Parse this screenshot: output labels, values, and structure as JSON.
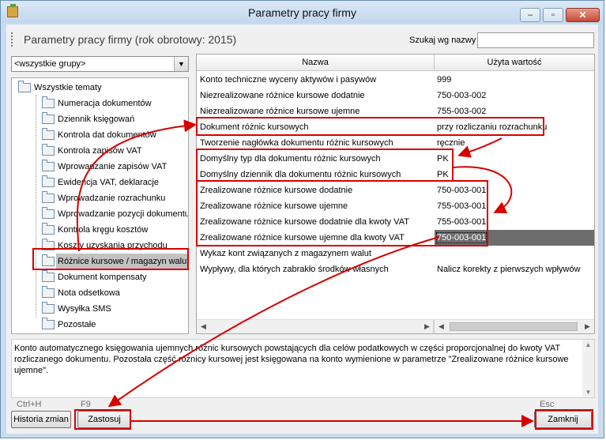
{
  "window": {
    "title": "Parametry pracy firmy",
    "min_symbol": "‒",
    "max_symbol": "▫",
    "close_symbol": "✕"
  },
  "header": {
    "page_title": "Parametry pracy firmy (rok obrotowy: 2015)",
    "search_label": "Szukaj wg nazwy",
    "search_value": ""
  },
  "group_select": {
    "value": "<wszystkie grupy>"
  },
  "tree": {
    "root": "Wszystkie tematy",
    "items": [
      "Numeracja dokumentów",
      "Dziennik księgowań",
      "Kontrola dat dokumentów",
      "Kontrola zapisów VAT",
      "Wprowadzanie zapisów VAT",
      "Ewidencja VAT, deklaracje",
      "Wprowadzanie rozrachunku",
      "Wprowadzanie pozycji dokumentu",
      "Kontrola kręgu kosztów",
      "Koszty uzyskania przychodu",
      "Różnice kursowe / magazyn walut",
      "Dokument kompensaty",
      "Nota odsetkowa",
      "Wysyłka SMS",
      "Pozostałe"
    ]
  },
  "grid": {
    "col_name": "Nazwa",
    "col_value": "Użyta wartość",
    "rows": [
      [
        "Konto techniczne wyceny aktywów i pasywów",
        "999"
      ],
      [
        "Niezrealizowane różnice kursowe dodatnie",
        "750-003-002"
      ],
      [
        "Niezrealizowane różnice kursowe ujemne",
        "755-003-002"
      ],
      [
        "Dokument różnic kursowych",
        "przy rozliczaniu rozrachunku"
      ],
      [
        "Tworzenie nagłówka dokumentu różnic kursowych",
        "ręcznie"
      ],
      [
        "Domyślny typ dla dokumentu różnic kursowych",
        "PK"
      ],
      [
        "Domyślny dziennik dla dokumentu różnic kursowych",
        "PK"
      ],
      [
        "Zrealizowane różnice kursowe dodatnie",
        "750-003-001"
      ],
      [
        "Zrealizowane różnice kursowe ujemne",
        "755-003-001"
      ],
      [
        "Zrealizowane różnice kursowe dodatnie dla kwoty VAT",
        "755-003-001"
      ],
      [
        "Zrealizowane różnice kursowe ujemne dla kwoty VAT",
        "750-003-001"
      ],
      [
        "Wykaz kont związanych z magazynem walut",
        ""
      ],
      [
        "Wypływy, dla których zabrakło środków własnych",
        "Nalicz korekty z pierwszych wpływów"
      ]
    ]
  },
  "description": "Konto automatycznego księgowania ujemnych różnic kursowych powstających dla celów podatkowych w części proporcjonalnej do kwoty VAT rozliczanego dokumentu. Pozostała część różnicy kursowej jest księgowana na konto wymienione w parametrze \"Zrealizowane różnice kursowe ujemne\".",
  "footer": {
    "history_shortcut": "Ctrl+H",
    "history_label": "Historia zmian",
    "apply_shortcut": "F9",
    "apply_label": "Zastosuj",
    "close_shortcut": "Esc",
    "close_label": "Zamknij"
  },
  "colors": {
    "annotation": "#d60000",
    "selection": "#6d6d6d"
  }
}
